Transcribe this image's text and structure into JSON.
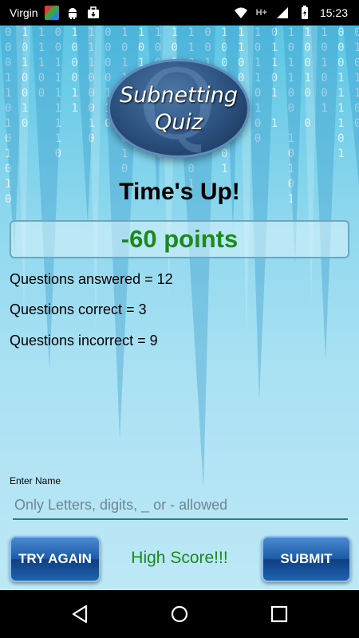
{
  "status_bar": {
    "carrier": "Virgin",
    "network": "H+",
    "time": "15:23",
    "icons": [
      "carrier-app-icon",
      "android-icon",
      "briefcase-icon",
      "wifi-icon",
      "signal-icon",
      "battery-charging-icon"
    ]
  },
  "logo": {
    "line1": "Subnetting",
    "line2": "Quiz"
  },
  "result": {
    "title": "Time's Up!",
    "points": "-60 points"
  },
  "stats": {
    "answered": "Questions answered = 12",
    "correct": "Questions correct = 3",
    "incorrect": "Questions incorrect = 9"
  },
  "name_field": {
    "label": "Enter Name",
    "placeholder": "Only Letters, digits, _ or - allowed",
    "value": ""
  },
  "actions": {
    "try_again": "TRY AGAIN",
    "high_score": "High Score!!!",
    "submit": "SUBMIT"
  },
  "colors": {
    "points": "#1a8a1a",
    "button": "#1b5aa6",
    "background": "#5cc6e4"
  }
}
